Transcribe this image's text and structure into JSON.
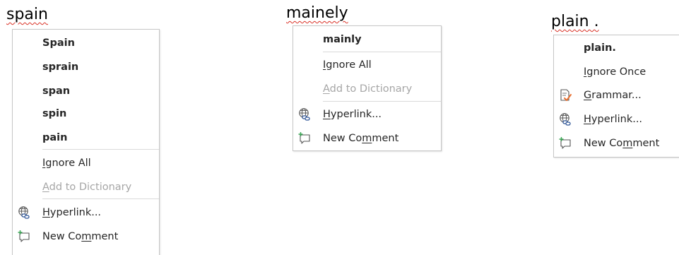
{
  "panels": [
    {
      "word": "spain",
      "suggestions": [
        "Spain",
        "sprain",
        "span",
        "spin",
        "pain"
      ],
      "ignore_all": "Ignore All",
      "add_to_dictionary": "Add to Dictionary",
      "hyperlink": "Hyperlink...",
      "new_comment": "New Comment"
    },
    {
      "word": "mainely",
      "suggestions": [
        "mainly"
      ],
      "ignore_all": "Ignore All",
      "add_to_dictionary": "Add to Dictionary",
      "hyperlink": "Hyperlink...",
      "new_comment": "New Comment"
    },
    {
      "word": "plain .",
      "suggestions": [
        "plain."
      ],
      "ignore_once": "Ignore Once",
      "grammar": "Grammar...",
      "hyperlink": "Hyperlink...",
      "new_comment": "New Comment"
    }
  ],
  "icons": {
    "hyperlink": "hyperlink-globe-icon",
    "new_comment": "new-comment-icon",
    "grammar": "grammar-check-icon"
  },
  "colors": {
    "spelling_squiggle": "#d93025",
    "disabled_text": "#a6a6a6",
    "menu_border": "#c6c6c6",
    "icon_blue": "#2f5597",
    "icon_green": "#3aa655",
    "icon_orange": "#e97132"
  }
}
